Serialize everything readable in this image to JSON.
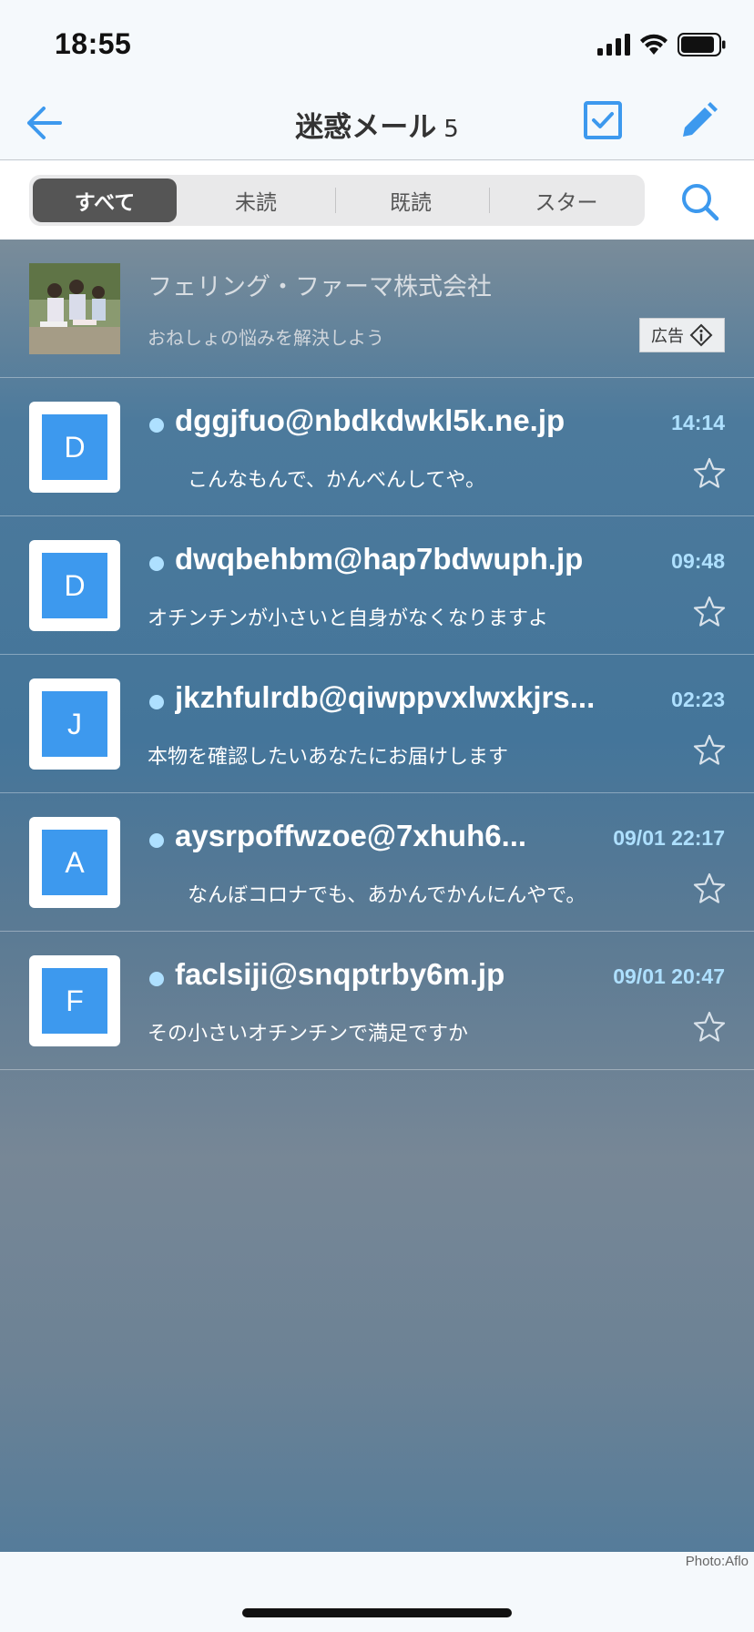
{
  "status_bar": {
    "time": "18:55",
    "icons": [
      "signal-icon",
      "wifi-icon",
      "battery-icon"
    ]
  },
  "nav": {
    "title": "迷惑メール",
    "count": "5",
    "icons": [
      "back-arrow-icon",
      "select-checkbox-icon",
      "compose-pencil-icon"
    ]
  },
  "filter": {
    "tabs": [
      {
        "label": "すべて",
        "active": true
      },
      {
        "label": "未読",
        "active": false
      },
      {
        "label": "既読",
        "active": false
      },
      {
        "label": "スター",
        "active": false
      }
    ],
    "search_icon": "search-icon"
  },
  "ad": {
    "sponsor": "フェリング・ファーマ株式会社",
    "text": "おねしょの悩みを解決しよう",
    "badge_label": "広告"
  },
  "mails": [
    {
      "initial": "D",
      "sender": "dggjfuo@nbdkdwkl5k.ne.jp",
      "time": "14:14",
      "snippet": "　　こんなもんで、かんべんしてや。",
      "unread": true,
      "starred": false
    },
    {
      "initial": "D",
      "sender": "dwqbehbm@hap7bdwuph.jp",
      "time": "09:48",
      "snippet": "オチンチンが小さいと自身がなくなりますよ",
      "unread": true,
      "starred": false
    },
    {
      "initial": "J",
      "sender": "jkzhfulrdb@qiwppvxlwxkjrs...",
      "time": "02:23",
      "snippet": "本物を確認したいあなたにお届けします",
      "unread": true,
      "starred": false
    },
    {
      "initial": "A",
      "sender": "aysrpoffwzoe@7xhuh6...",
      "time": "09/01 22:17",
      "snippet": "　　なんぼコロナでも、あかんでかんにんやで。",
      "unread": true,
      "starred": false
    },
    {
      "initial": "F",
      "sender": "faclsiji@snqptrby6m.jp",
      "time": "09/01 20:47",
      "snippet": "その小さいオチンチンで満足ですか",
      "unread": true,
      "starred": false
    }
  ],
  "footer": {
    "photo_credit": "Photo:Aflo"
  },
  "colors": {
    "accent": "#3d99ee",
    "unread_dot": "#aee0ff",
    "active_tab": "#555555"
  }
}
